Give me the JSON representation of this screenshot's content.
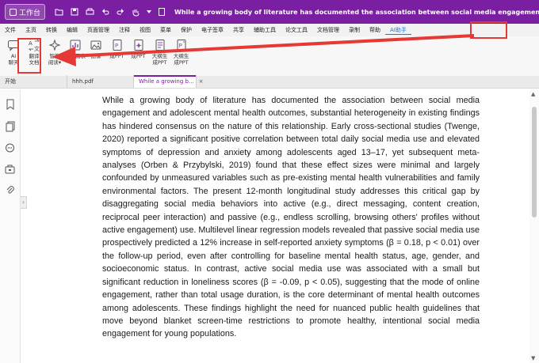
{
  "titlebar": {
    "workbench_label": "工作台",
    "title": "While a growing body of literature has documented the association between social media engagement and adolescent mental health outcomes"
  },
  "menubar": {
    "items": [
      "文件",
      "主页",
      "转换",
      "编辑",
      "页面管理",
      "注释",
      "视图",
      "菜单",
      "保护",
      "电子签章",
      "共享",
      "辅助工具",
      "论文工具",
      "文档管理",
      "录制",
      "帮助"
    ],
    "active": "AI助手"
  },
  "ribbon": {
    "items": [
      {
        "line1": "AI",
        "line2": "聊天"
      },
      {
        "line1": "翻译",
        "line2": "文档"
      },
      {
        "line1": "智能",
        "line2": "阅读▾"
      },
      {
        "line1": "",
        "line2": "智能图表"
      },
      {
        "line1": "",
        "line2": "图像"
      },
      {
        "line1": "",
        "line2": "成PPT"
      },
      {
        "line1": "",
        "line2": "成PPT"
      },
      {
        "line1": "大纲生",
        "line2": "成PPT"
      },
      {
        "line1": "大纲生",
        "line2": "成PPT"
      }
    ]
  },
  "tabs": {
    "home": "开始",
    "file1": "hhh.pdf",
    "current": "While a growing b...",
    "close": "×"
  },
  "document": {
    "paragraph": "While a growing body of literature has documented the association between social media engagement and adolescent mental health outcomes, substantial heterogeneity in existing findings has hindered consensus on the nature of this relationship. Early cross-sectional studies (Twenge, 2020) reported a significant positive correlation between total daily social media use and elevated symptoms of depression and anxiety among adolescents aged 13–17, yet subsequent meta-analyses (Orben & Przybylski, 2019) found that these effect sizes were minimal and largely confounded by unmeasured variables such as pre-existing mental health vulnerabilities and family environmental factors. The present 12-month longitudinal study addresses this critical gap by disaggregating social media behaviors into active (e.g., direct messaging, content creation, reciprocal peer interaction) and passive (e.g., endless scrolling, browsing others' profiles without active engagement) use. Multilevel linear regression models revealed that passive social media use prospectively predicted a 12% increase in self-reported anxiety symptoms (β = 0.18, p < 0.01) over the follow-up period, even after controlling for baseline mental health status, age, gender, and socioeconomic status. In contrast, active social media use was associated with a small but significant reduction in loneliness scores (β = -0.09, p < 0.05), suggesting that the mode of online engagement, rather than total usage duration, is the core determinant of mental health outcomes among adolescents. These findings highlight the need for nuanced public health guidelines that move beyond blanket screen-time restrictions to promote healthy, intentional social media engagement for young populations."
  },
  "colors": {
    "titlebar": "#7b1fa2",
    "accent": "#1a73e8",
    "annotation": "#e53935"
  },
  "icons": [
    "workbench-logo-icon",
    "folder-icon",
    "save-icon",
    "print-icon",
    "undo-icon",
    "redo-icon",
    "hand-icon",
    "dropdown-icon",
    "document-icon",
    "thumbnail-icon",
    "pages-icon",
    "comment-icon",
    "toolbox-icon",
    "attachment-icon"
  ]
}
